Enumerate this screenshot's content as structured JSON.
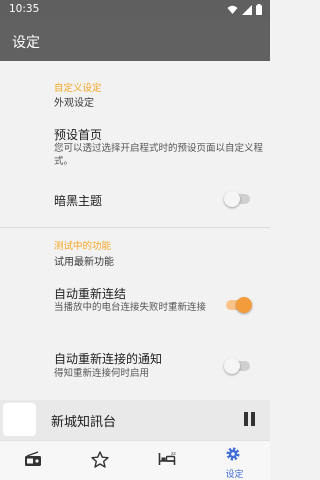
{
  "status_bar": {
    "time": "10:35"
  },
  "app_bar": {
    "title": "设定"
  },
  "sections": [
    {
      "category": "自定义设定",
      "category_summary": "外观设定"
    },
    {
      "category": "测试中的功能",
      "category_summary": "试用最新功能"
    }
  ],
  "prefs": {
    "home_page": {
      "title": "预设首页",
      "summary": "您可以透过选择开启程式时的预设页面以自定义程式。"
    },
    "dark_theme": {
      "title": "暗黑主题",
      "enabled": false
    },
    "auto_reconnect": {
      "title": "自动重新连结",
      "summary": "当播放中的电台连接失败时重新连接",
      "enabled": true
    },
    "reconnect_notify": {
      "title": "自动重新连接的通知",
      "summary": "得知重新连接何时启用",
      "enabled": false
    }
  },
  "player": {
    "station": "新城知訊台",
    "state": "playing"
  },
  "bottom_nav": {
    "items": [
      {
        "icon": "radio-icon",
        "label": ""
      },
      {
        "icon": "star-icon",
        "label": ""
      },
      {
        "icon": "bed-icon",
        "label": ""
      },
      {
        "icon": "settings-icon",
        "label": "设定",
        "active": true
      }
    ]
  },
  "colors": {
    "accent": "#f39c3c",
    "category": "#f5a623",
    "app_bar": "#616161",
    "nav_active": "#3f6ed6"
  }
}
